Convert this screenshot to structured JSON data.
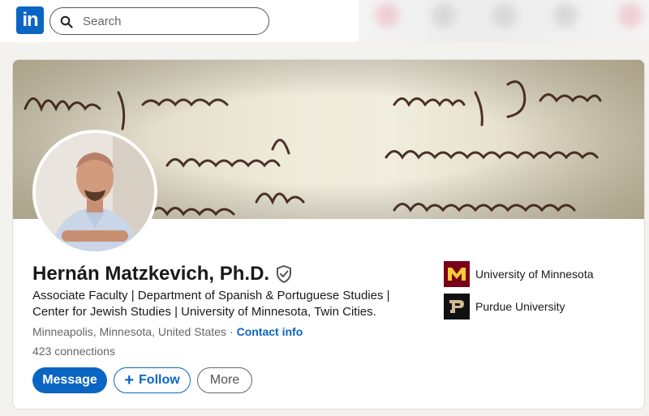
{
  "nav": {
    "logo_text": "in",
    "search_placeholder": "Search"
  },
  "profile": {
    "name": "Hernán Matzkevich, Ph.D.",
    "headline_line1": "Associate Faculty | Department of Spanish & Portuguese Studies |",
    "headline_line2": "Center for Jewish Studies | University of Minnesota, Twin Cities.",
    "location": "Minneapolis, Minnesota, United States",
    "separator": "·",
    "contact_label": "Contact info",
    "connections": "423 connections"
  },
  "actions": {
    "message_label": "Message",
    "follow_label": "Follow",
    "more_label": "More"
  },
  "education": [
    {
      "name": "University of Minnesota",
      "color": "#7a0019"
    },
    {
      "name": "Purdue University",
      "color": "#111111"
    }
  ],
  "colors": {
    "brand": "#0a66c2",
    "background": "#f3f2ef"
  }
}
